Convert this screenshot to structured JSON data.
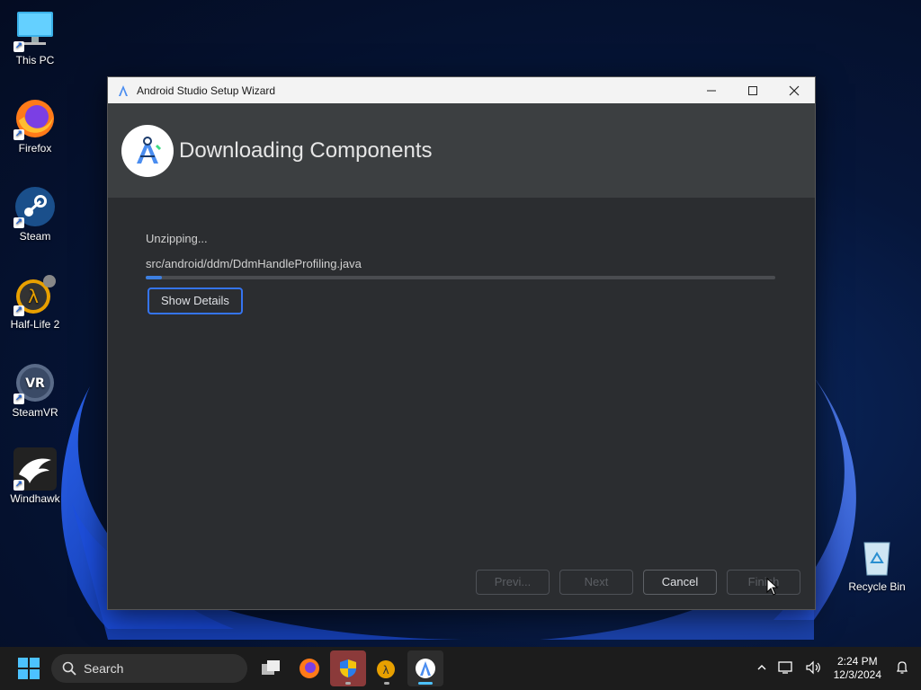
{
  "desktop": {
    "icons": [
      {
        "label": "This PC"
      },
      {
        "label": "Firefox"
      },
      {
        "label": "Steam"
      },
      {
        "label": "Half-Life 2"
      },
      {
        "label": "SteamVR"
      },
      {
        "label": "Windhawk"
      },
      {
        "label": "Recycle Bin"
      }
    ]
  },
  "window": {
    "title": "Android Studio Setup Wizard",
    "header_title": "Downloading Components",
    "status": "Unzipping...",
    "current_file": "src/android/ddm/DdmHandleProfiling.java",
    "progress_fraction": 0.025,
    "show_details_label": "Show Details",
    "buttons": {
      "previous": "Previ...",
      "next": "Next",
      "cancel": "Cancel",
      "finish": "Finish"
    },
    "colors": {
      "accent": "#3574f0",
      "progress": "#3d7fe0"
    }
  },
  "taskbar": {
    "search_placeholder": "Search",
    "time": "2:24 PM",
    "date": "12/3/2024"
  }
}
